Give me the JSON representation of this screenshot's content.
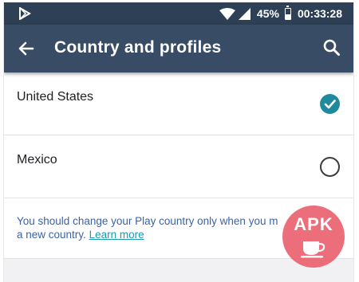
{
  "status_bar": {
    "notification_icon": "play-store-icon",
    "battery_percent": "45%",
    "time": "00:33:28",
    "battery_level": 0.45
  },
  "app_bar": {
    "back_icon": "arrow-left-icon",
    "title": "Country and profiles",
    "search_icon": "search-icon"
  },
  "countries": [
    {
      "name": "United States",
      "selected": true
    },
    {
      "name": "Mexico",
      "selected": false
    }
  ],
  "info": {
    "text": "You should change your Play country only when you m",
    "text_line2": "a new country.",
    "link": "Learn more"
  },
  "watermark": {
    "label": "APK"
  },
  "colors": {
    "status_bar": "#2e4055",
    "app_bar": "#384c65",
    "accent": "#1f8a9e",
    "info_text": "#3a63a8",
    "link": "#1a9bb0",
    "watermark": "#ec6270"
  }
}
